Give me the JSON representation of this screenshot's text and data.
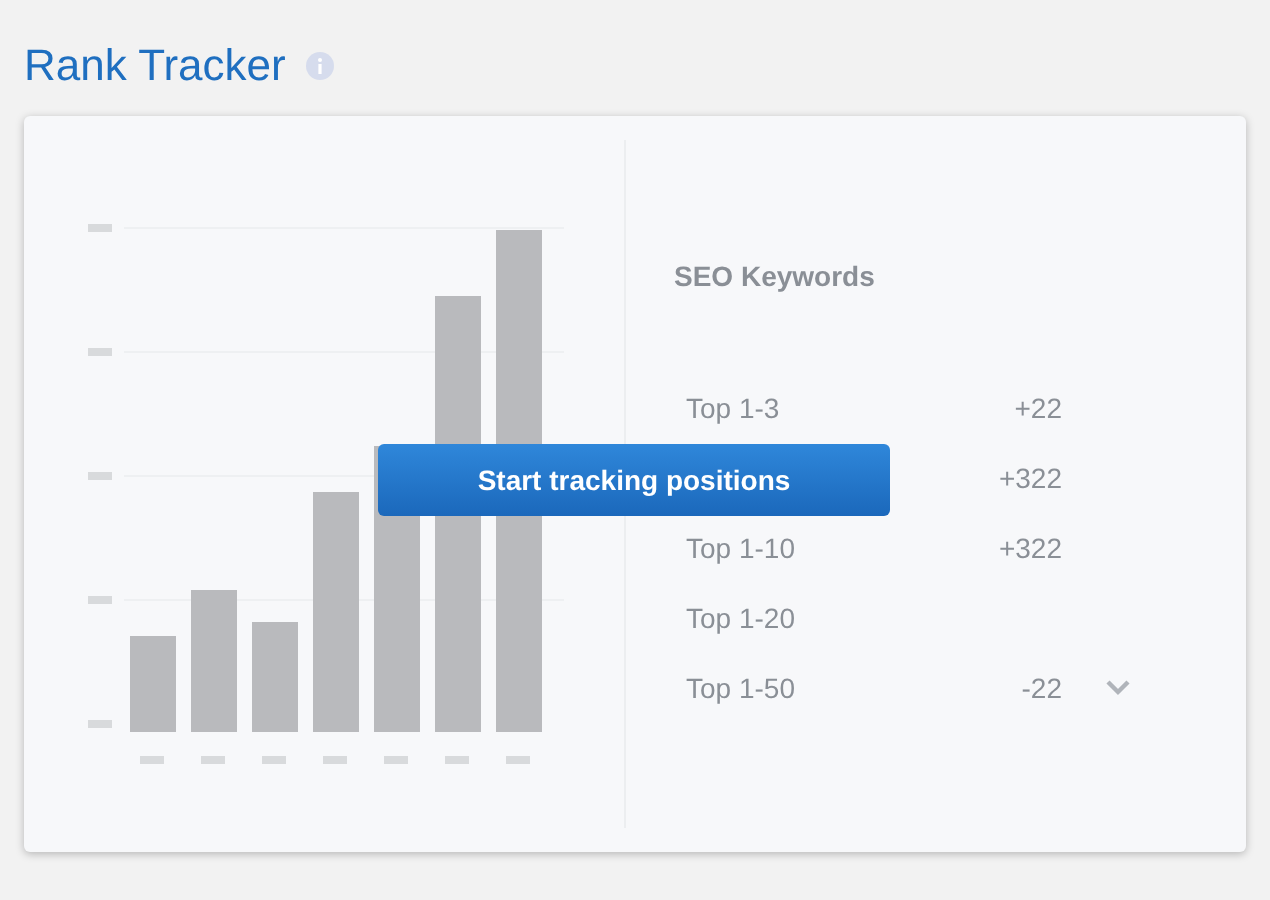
{
  "header": {
    "title": "Rank Tracker"
  },
  "overlay": {
    "button": "Start tracking positions"
  },
  "keywords": {
    "title": "SEO Keywords",
    "rows": [
      {
        "label": "Top 1-3",
        "value": "+22"
      },
      {
        "value": "+322"
      },
      {
        "label": "Top 1-10",
        "value": "+322"
      },
      {
        "label": "Top 1-20"
      },
      {
        "label": "Top 1-50",
        "value": "-22",
        "expandable": true
      }
    ]
  }
}
